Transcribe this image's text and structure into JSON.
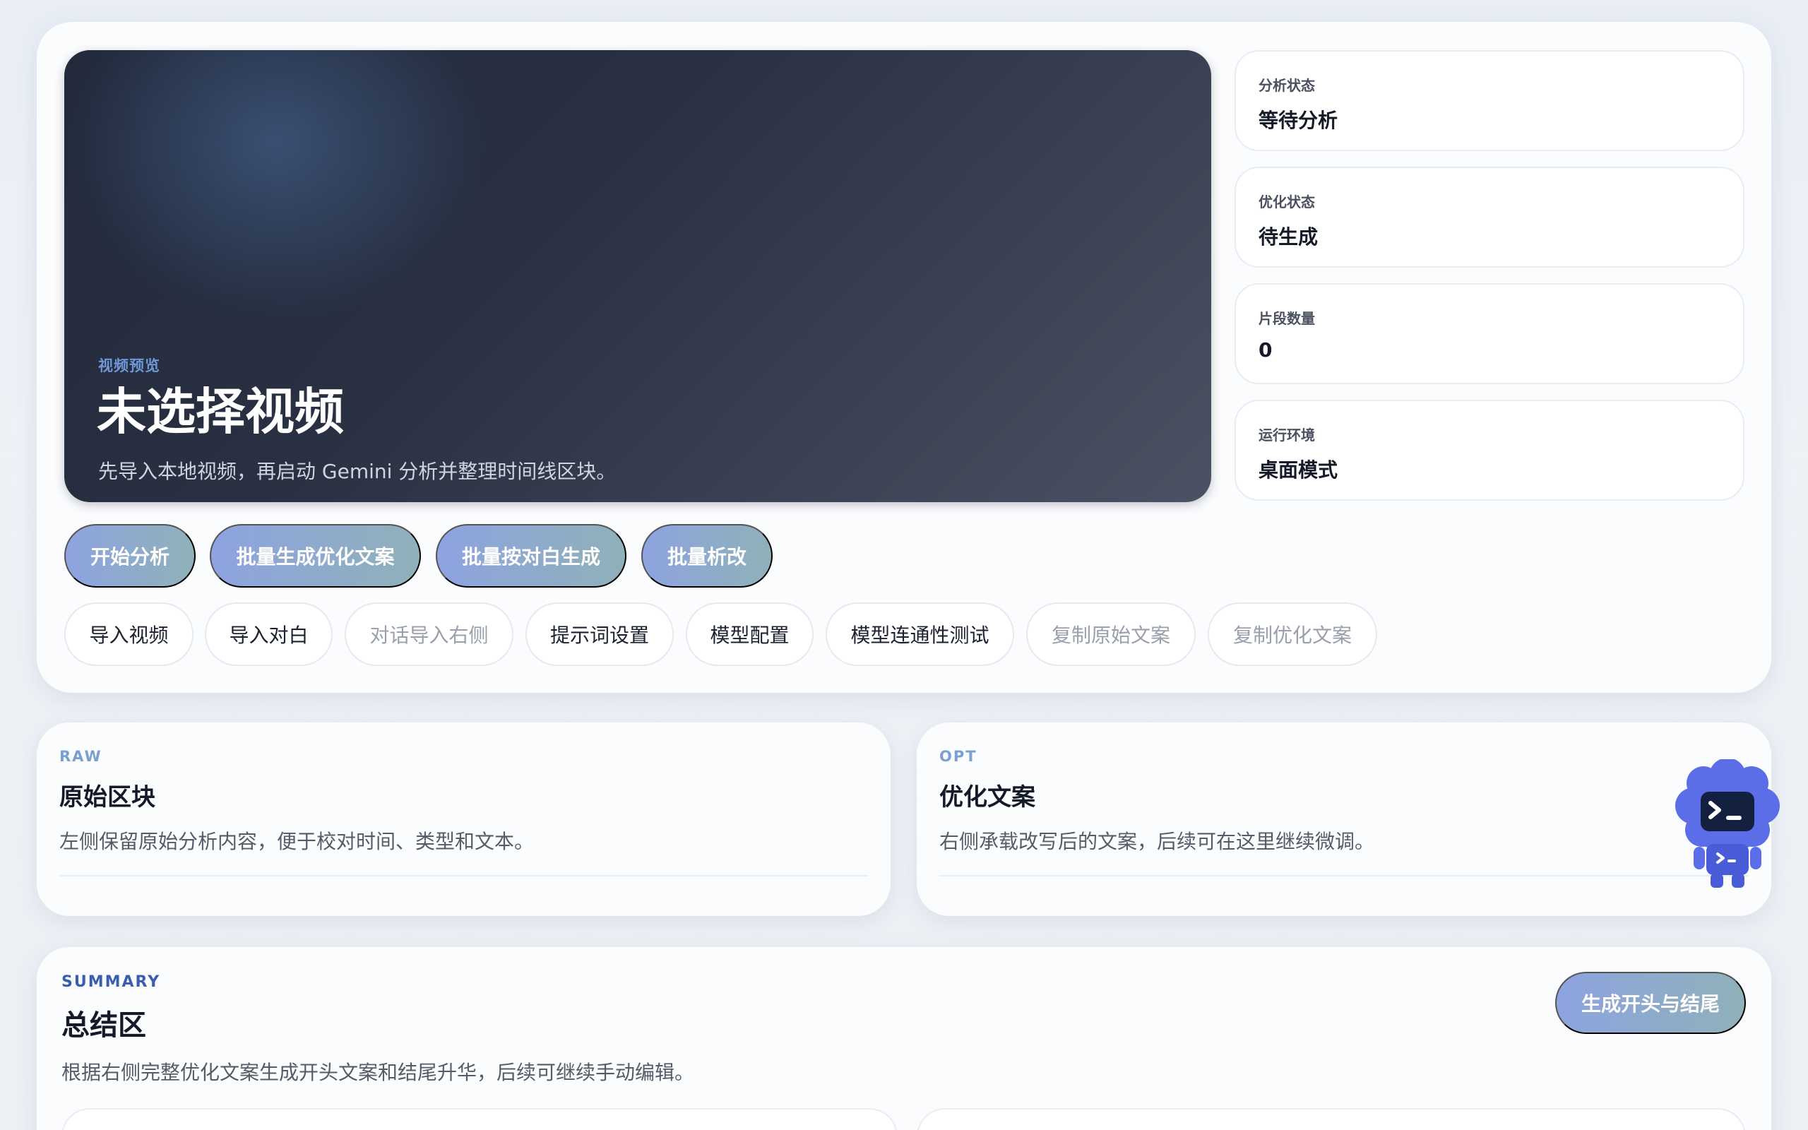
{
  "hero": {
    "eyebrow": "视频预览",
    "title": "未选择视频",
    "description": "先导入本地视频，再启动 Gemini 分析并整理时间线区块。"
  },
  "status_cards": [
    {
      "label": "分析状态",
      "value": "等待分析"
    },
    {
      "label": "优化状态",
      "value": "待生成"
    },
    {
      "label": "片段数量",
      "value": "0"
    },
    {
      "label": "运行环境",
      "value": "桌面模式"
    }
  ],
  "primary_actions": [
    {
      "label": "开始分析"
    },
    {
      "label": "批量生成优化文案"
    },
    {
      "label": "批量按对白生成"
    },
    {
      "label": "批量析改"
    }
  ],
  "secondary_actions": [
    {
      "label": "导入视频",
      "enabled": true
    },
    {
      "label": "导入对白",
      "enabled": true
    },
    {
      "label": "对话导入右侧",
      "enabled": false
    },
    {
      "label": "提示词设置",
      "enabled": true
    },
    {
      "label": "模型配置",
      "enabled": true
    },
    {
      "label": "模型连通性测试",
      "enabled": true
    },
    {
      "label": "复制原始文案",
      "enabled": false
    },
    {
      "label": "复制优化文案",
      "enabled": false
    }
  ],
  "raw_panel": {
    "eyebrow": "RAW",
    "title": "原始区块",
    "description": "左侧保留原始分析内容，便于校对时间、类型和文本。"
  },
  "opt_panel": {
    "eyebrow": "OPT",
    "title": "优化文案",
    "description": "右侧承载改写后的文案，后续可在这里继续微调。"
  },
  "summary": {
    "eyebrow": "SUMMARY",
    "title": "总结区",
    "description": "根据右侧完整优化文案生成开头文案和结尾升华，后续可继续手动编辑。",
    "action_label": "生成开头与结尾"
  },
  "mascot": {
    "icon": "robot-mascot-icon",
    "color": "#5b6ee8"
  },
  "colors": {
    "primary_gradient_start": "#8ea3e0",
    "primary_gradient_end": "#8fb1b9",
    "accent_blue": "#3a5db0"
  }
}
